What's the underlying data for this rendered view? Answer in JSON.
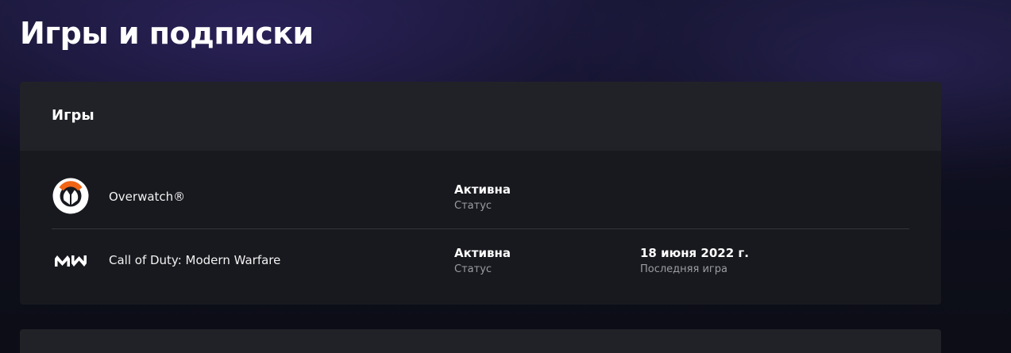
{
  "page": {
    "title": "Игры и подписки"
  },
  "games_section": {
    "title": "Игры",
    "games": [
      {
        "icon": "overwatch-logo-icon",
        "name": "Overwatch®",
        "status_value": "Активна",
        "status_label": "Статус"
      },
      {
        "icon": "modern-warfare-logo-icon",
        "name": "Call of Duty: Modern Warfare",
        "status_value": "Активна",
        "status_label": "Статус",
        "last_played_value": "18 июня 2022 г.",
        "last_played_label": "Последняя игра"
      }
    ]
  },
  "colors": {
    "overwatch_orange": "#f06414",
    "card_background": "#18191e",
    "card_header_background": "#212227",
    "muted_text": "#9b9ca3"
  }
}
